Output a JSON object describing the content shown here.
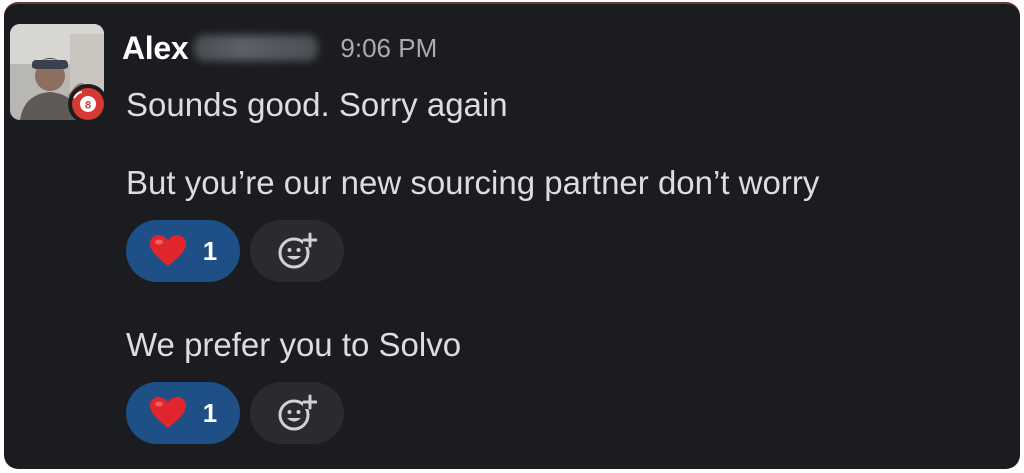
{
  "message": {
    "author": "Alex",
    "timestamp": "9:06 PM",
    "badge_number": "8",
    "lines": [
      "Sounds good. Sorry again",
      "But you’re our new sourcing partner don’t worry",
      "We prefer you to Solvo"
    ],
    "reactions": [
      {
        "emoji": "heart-emoji",
        "count": "1"
      },
      {
        "emoji": "heart-emoji",
        "count": "1"
      }
    ]
  },
  "colors": {
    "background": "#1b1c20",
    "reaction_active": "#1e4f86",
    "reaction_add": "#2a2b30",
    "badge_red": "#d73a32",
    "text_primary": "#dcdde0",
    "text_muted": "#a9abb0"
  },
  "icons": {
    "add_reaction": "add-emoji-icon",
    "heart": "heart-emoji",
    "avatar_badge": "pool-ball-badge-icon"
  }
}
